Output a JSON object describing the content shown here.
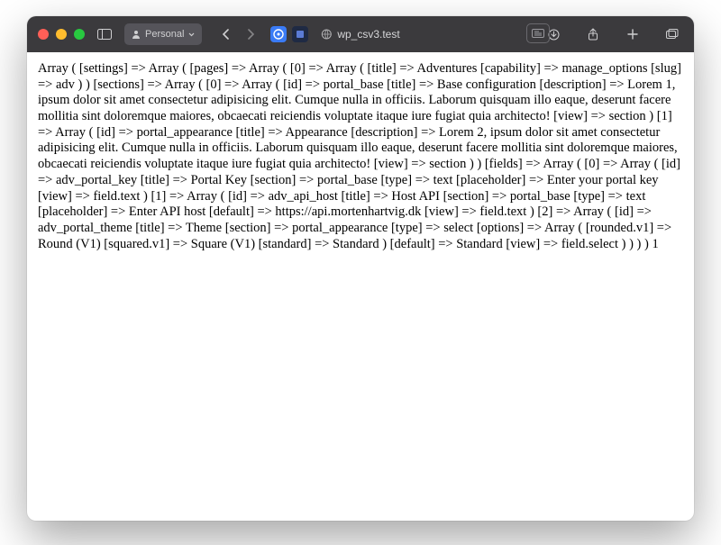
{
  "titlebar": {
    "profile_label": "Personal",
    "address": "wp_csv3.test"
  },
  "dump_text": "Array ( [settings] => Array ( [pages] => Array ( [0] => Array ( [title] => Adventures [capability] => manage_options [slug] => adv ) ) [sections] => Array ( [0] => Array ( [id] => portal_base [title] => Base configuration [description] => Lorem 1, ipsum dolor sit amet consectetur adipisicing elit. Cumque nulla in officiis. Laborum quisquam illo eaque, deserunt facere mollitia sint doloremque maiores, obcaecati reiciendis voluptate itaque iure fugiat quia architecto! [view] => section ) [1] => Array ( [id] => portal_appearance [title] => Appearance [description] => Lorem 2, ipsum dolor sit amet consectetur adipisicing elit. Cumque nulla in officiis. Laborum quisquam illo eaque, deserunt facere mollitia sint doloremque maiores, obcaecati reiciendis voluptate itaque iure fugiat quia architecto! [view] => section ) ) [fields] => Array ( [0] => Array ( [id] => adv_portal_key [title] => Portal Key [section] => portal_base [type] => text [placeholder] => Enter your portal key [view] => field.text ) [1] => Array ( [id] => adv_api_host [title] => Host API [section] => portal_base [type] => text [placeholder] => Enter API host [default] => https://api.mortenhartvig.dk [view] => field.text ) [2] => Array ( [id] => adv_portal_theme [title] => Theme [section] => portal_appearance [type] => select [options] => Array ( [rounded.v1] => Round (V1) [squared.v1] => Square (V1) [standard] => Standard ) [default] => Standard [view] => field.select ) ) ) ) 1"
}
